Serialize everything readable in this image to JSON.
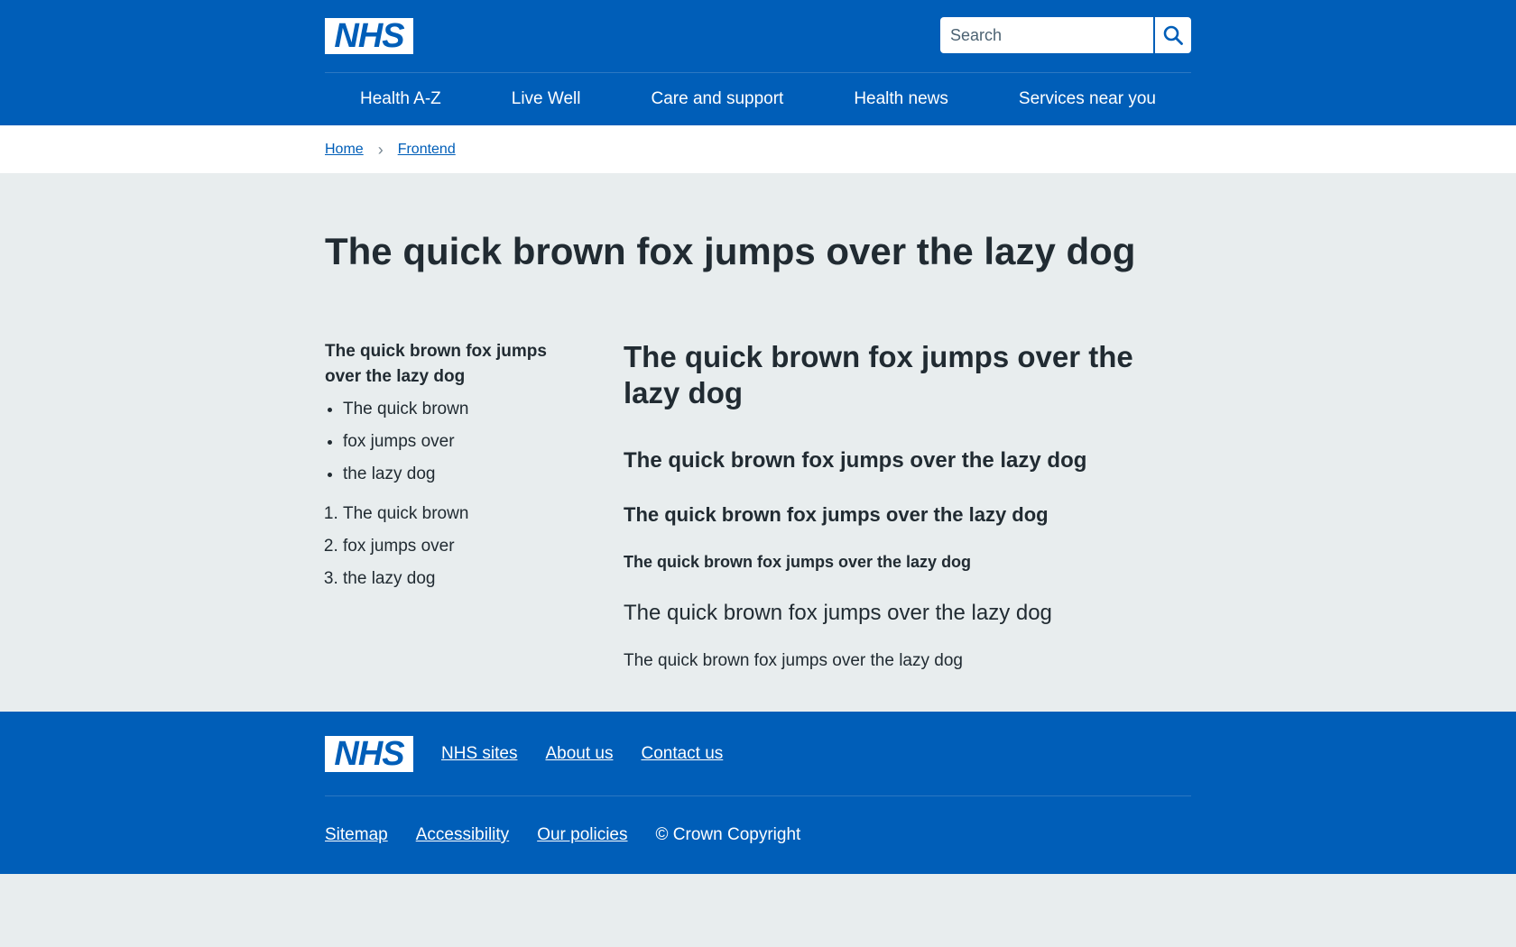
{
  "header": {
    "logo_text": "NHS",
    "search": {
      "placeholder": "Search"
    },
    "nav": [
      {
        "label": "Health A-Z"
      },
      {
        "label": "Live Well"
      },
      {
        "label": "Care and support"
      },
      {
        "label": "Health news"
      },
      {
        "label": "Services near you"
      }
    ]
  },
  "breadcrumb": [
    {
      "label": "Home"
    },
    {
      "label": "Frontend"
    }
  ],
  "main": {
    "title": "The quick brown fox jumps over the lazy dog",
    "left": {
      "heading": "The quick brown fox jumps over the lazy dog",
      "bullets": [
        "The quick brown",
        "fox jumps over",
        "the lazy dog"
      ],
      "numbered": [
        "The quick brown",
        "fox jumps over",
        "the lazy dog"
      ]
    },
    "right": {
      "h1": "The quick brown fox jumps over the lazy dog",
      "h2": "The quick brown fox jumps over the lazy dog",
      "h3": "The quick brown fox jumps over the lazy dog",
      "h4": "The quick brown fox jumps over the lazy dog",
      "lead": "The quick brown fox jumps over the lazy dog",
      "body": "The quick brown fox jumps over the lazy dog"
    }
  },
  "footer": {
    "logo_text": "NHS",
    "primary_links": [
      "NHS sites",
      "About us",
      "Contact us"
    ],
    "secondary_links": [
      "Sitemap",
      "Accessibility",
      "Our policies"
    ],
    "copyright": "© Crown Copyright"
  },
  "colors": {
    "brand_blue": "#005eb8",
    "background": "#e8edee",
    "text": "#212b32"
  }
}
